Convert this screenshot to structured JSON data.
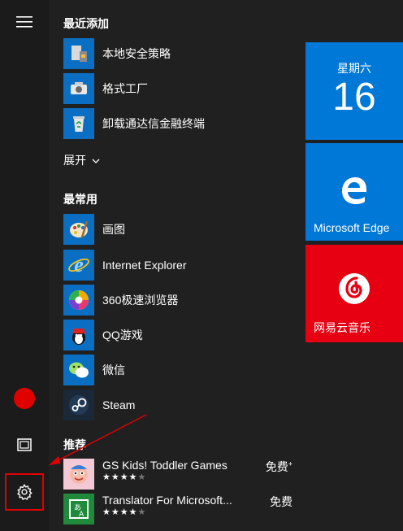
{
  "sections": {
    "recent": "最近添加",
    "frequent": "最常用",
    "recommended": "推荐"
  },
  "expand_label": "展开",
  "recent_apps": [
    {
      "label": "本地安全策略",
      "icon": "security-policy-icon"
    },
    {
      "label": "格式工厂",
      "icon": "format-factory-icon"
    },
    {
      "label": "卸载通达信金融终端",
      "icon": "recycle-bin-icon"
    }
  ],
  "frequent_apps": [
    {
      "label": "画图",
      "icon": "paint-palette-icon"
    },
    {
      "label": "Internet Explorer",
      "icon": "internet-explorer-icon"
    },
    {
      "label": "360极速浏览器",
      "icon": "360-browser-icon"
    },
    {
      "label": "QQ游戏",
      "icon": "qq-game-icon"
    },
    {
      "label": "微信",
      "icon": "wechat-icon"
    },
    {
      "label": "Steam",
      "icon": "steam-icon"
    }
  ],
  "recommended_apps": [
    {
      "name": "GS Kids! Toddler Games",
      "price": "免费",
      "price_mark": "+",
      "rating": 4
    },
    {
      "name": "Translator For Microsoft...",
      "price": "免费",
      "rating": 4
    }
  ],
  "tiles": {
    "calendar": {
      "day": "星期六",
      "date": "16",
      "color": "#0078d7"
    },
    "edge": {
      "label": "Microsoft Edge",
      "color": "#0078d7"
    },
    "music": {
      "label": "网易云音乐",
      "color": "#e60012"
    }
  },
  "colors": {
    "accent": "#0078d7",
    "highlight": "#e00000"
  },
  "rail": {
    "menu": "hamburger-icon",
    "user": "avatar",
    "documents": "documents-icon",
    "settings": "gear-icon"
  }
}
